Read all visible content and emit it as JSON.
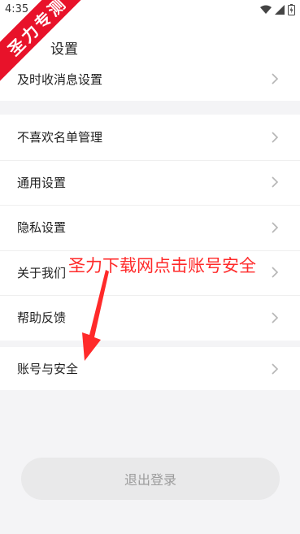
{
  "status_bar": {
    "time": "4:35"
  },
  "header": {
    "title": "设置"
  },
  "groups": [
    {
      "items": [
        {
          "label": "及时收消息设置"
        }
      ]
    },
    {
      "items": [
        {
          "label": "不喜欢名单管理"
        },
        {
          "label": "通用设置"
        },
        {
          "label": "隐私设置"
        },
        {
          "label": "关于我们"
        },
        {
          "label": "帮助反馈"
        }
      ]
    },
    {
      "items": [
        {
          "label": "账号与安全"
        }
      ]
    }
  ],
  "logout": {
    "label": "退出登录"
  },
  "overlay": {
    "watermark": "圣力专测",
    "annotation": "圣力下载网点击账号安全"
  },
  "colors": {
    "background": "#f4f4f6",
    "annotation": "#ff2a2a",
    "watermark": "#e8122a"
  }
}
